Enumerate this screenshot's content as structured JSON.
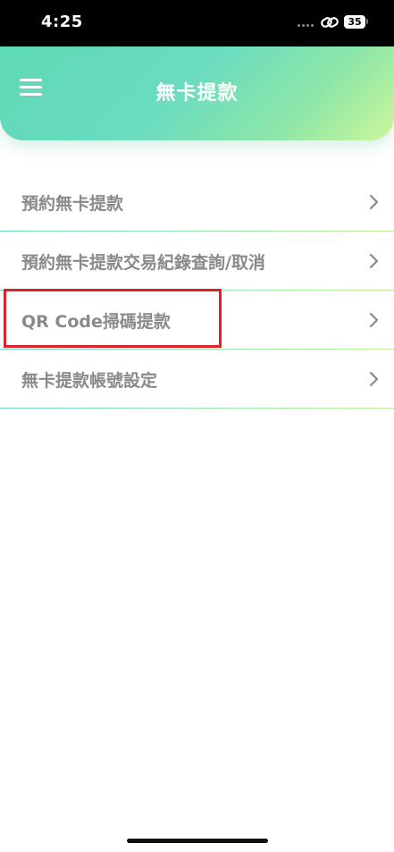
{
  "status_bar": {
    "time": "4:25",
    "battery": "35"
  },
  "header": {
    "title": "無卡提款"
  },
  "menu": {
    "items": [
      {
        "label": "預約無卡提款"
      },
      {
        "label": "預約無卡提款交易紀錄查詢/取消"
      },
      {
        "label": "QR Code掃碼提款"
      },
      {
        "label": "無卡提款帳號設定"
      }
    ]
  },
  "colors": {
    "header_gradient_start": "#5fd9b5",
    "header_gradient_end": "#cdf79a",
    "item_text": "#8a8a8a",
    "highlight": "#e0202a"
  },
  "icons": [
    "hamburger-menu-icon",
    "chevron-right-icon",
    "link-icon",
    "battery-icon"
  ]
}
